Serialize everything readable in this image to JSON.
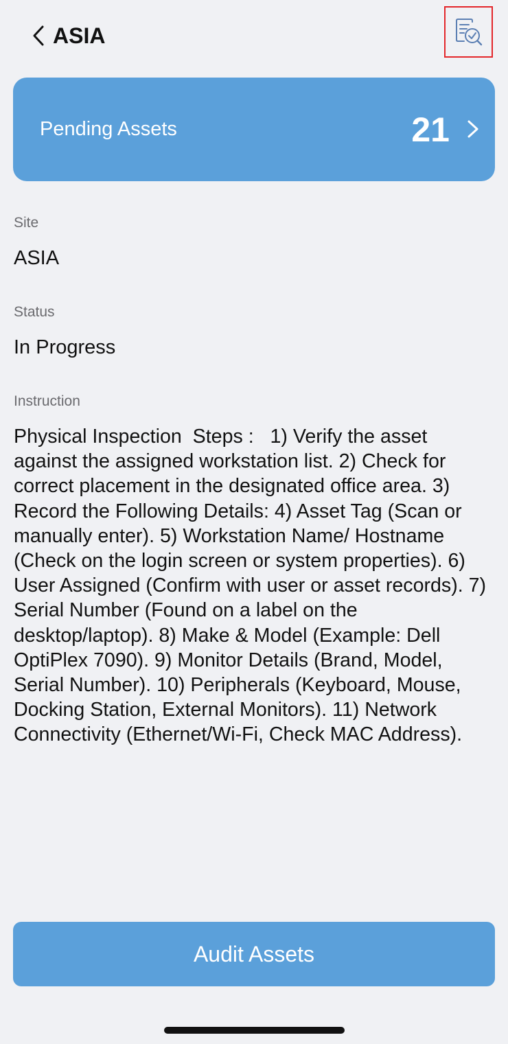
{
  "header": {
    "back_icon": "chevron-left-icon",
    "title": "ASIA",
    "action_icon": "document-check-search-icon"
  },
  "pending_card": {
    "label": "Pending Assets",
    "count": "21",
    "chevron_icon": "chevron-right-icon"
  },
  "fields": {
    "site_label": "Site",
    "site_value": "ASIA",
    "status_label": "Status",
    "status_value": "In Progress",
    "instruction_label": "Instruction",
    "instruction_value": "Physical Inspection  Steps :   1) Verify the asset against the assigned workstation list. 2) Check for correct placement in the designated office area. 3) Record the Following Details: 4) Asset Tag (Scan or manually enter). 5) Workstation Name/ Hostname (Check on the login screen or system properties). 6) User Assigned (Confirm with user or asset records). 7) Serial Number (Found on a label on the desktop/laptop). 8) Make & Model (Example: Dell OptiPlex 7090). 9) Monitor Details (Brand, Model, Serial Number). 10) Peripherals (Keyboard, Mouse, Docking Station, External Monitors). 11) Network Connectivity (Ethernet/Wi-Fi, Check MAC Address)."
  },
  "footer": {
    "audit_button_label": "Audit Assets"
  },
  "colors": {
    "accent": "#5ba0da",
    "background": "#f0f1f4",
    "highlight_border": "#e3262a",
    "label_gray": "#6a6a6e"
  }
}
